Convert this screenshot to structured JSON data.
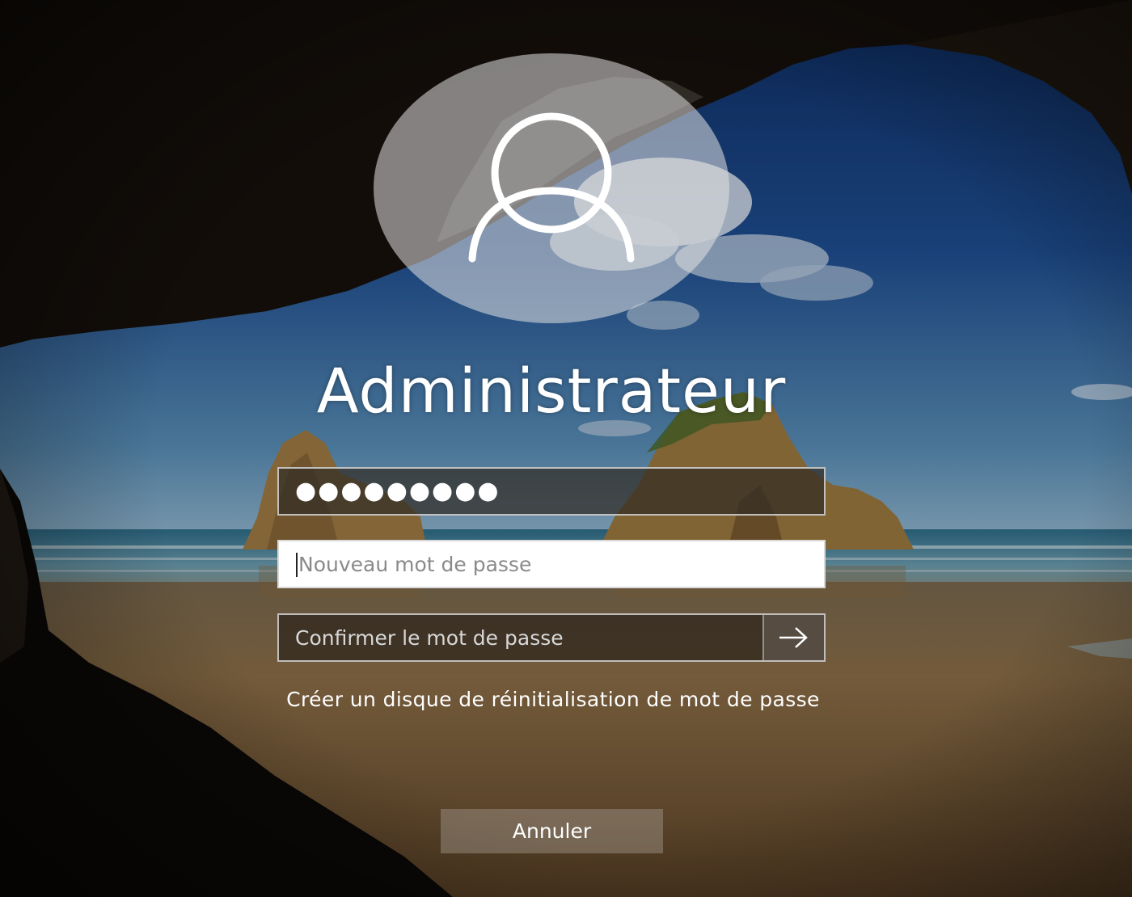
{
  "user": {
    "name": "Administrateur",
    "avatar_icon": "user-silhouette-icon"
  },
  "old_password": {
    "masked_value": "●●●●●●●●●"
  },
  "new_password": {
    "placeholder": "Nouveau mot de passe"
  },
  "confirm_password": {
    "placeholder": "Confirmer le mot de passe",
    "submit_icon": "arrow-right-icon"
  },
  "links": {
    "reset_disk": "Créer un disque de réinitialisation de mot de passe"
  },
  "buttons": {
    "cancel": "Annuler"
  },
  "colors": {
    "sky": "#1f4c8f",
    "sea": "#4d8aa5",
    "sand": "#8a6a45",
    "cave": "#120e0b"
  }
}
